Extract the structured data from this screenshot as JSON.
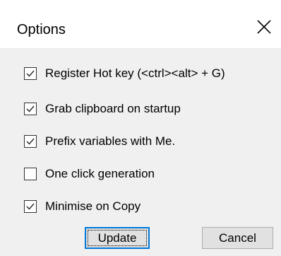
{
  "dialog": {
    "title": "Options",
    "close_icon": "close-icon"
  },
  "options": [
    {
      "label": "Register Hot key (<ctrl><alt> + G)",
      "checked": true
    },
    {
      "label": "Grab clipboard on startup",
      "checked": true
    },
    {
      "label": "Prefix variables with Me.",
      "checked": true
    },
    {
      "label": "One click generation",
      "checked": false
    },
    {
      "label": "Minimise on Copy",
      "checked": true
    }
  ],
  "buttons": {
    "update_label": "Update",
    "cancel_label": "Cancel"
  },
  "colors": {
    "accent": "#0078d7",
    "content_background": "#f0f0f0",
    "button_face": "#e1e1e1"
  }
}
